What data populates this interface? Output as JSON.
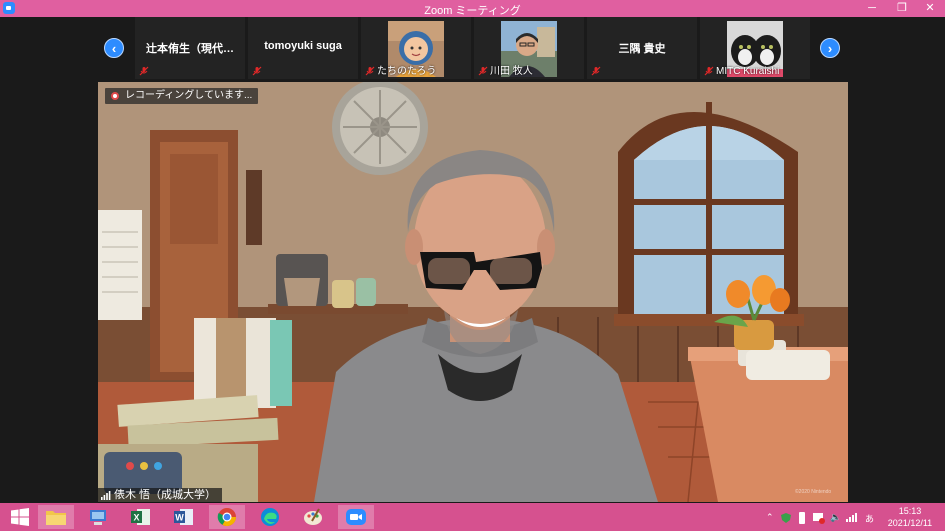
{
  "window": {
    "title": "Zoom ミーティング",
    "minimize_glyph": "─",
    "maximize_glyph": "❐",
    "close_glyph": "✕"
  },
  "strip": {
    "prev_glyph": "‹",
    "next_glyph": "›",
    "participants": [
      {
        "name": "辻本侑生（現代…",
        "video": false
      },
      {
        "name": "tomoyuki suga",
        "video": false
      },
      {
        "name": "たちのたろう",
        "video": true
      },
      {
        "name": "川田 牧人",
        "video": true
      },
      {
        "name": "三隅 貴史",
        "video": false
      },
      {
        "name": "MITC Kuraishi",
        "video": true
      }
    ]
  },
  "main": {
    "recording_text": "レコーディングしています...",
    "speaker_name": "俵木 悟（成城大学）",
    "watermark": "©2020 Nintendo"
  },
  "taskbar": {
    "apps": [
      "start",
      "file-explorer",
      "control-panel",
      "excel",
      "word",
      "chrome",
      "edge",
      "paint",
      "zoom"
    ],
    "ime_indicator": "あ",
    "time": "15:13",
    "date": "2021/12/11"
  },
  "colors": {
    "accent": "#e05fa0",
    "taskbar": "#d6518f",
    "zoom_blue": "#2d8cff",
    "mute_red": "#e02828"
  }
}
